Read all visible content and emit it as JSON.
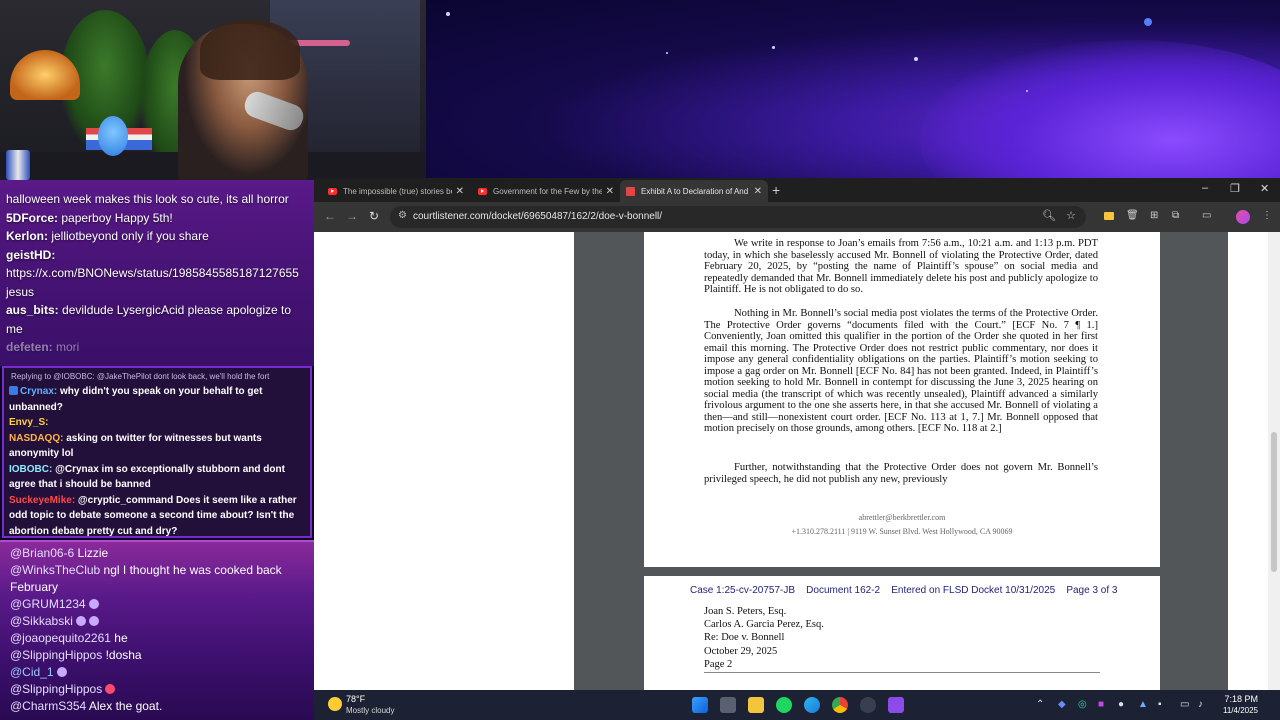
{
  "browser": {
    "tabs": [
      {
        "title": "The impossible (true) stories be",
        "favicon": "youtube-icon",
        "active": false
      },
      {
        "title": "Government for the Few by the",
        "favicon": "youtube-icon",
        "active": false
      },
      {
        "title": "Exhibit A to Declaration of And",
        "favicon": "pdf-icon",
        "active": true
      }
    ],
    "new_tab": "+",
    "minimize": "–",
    "restore": "❐",
    "close": "✕",
    "url": "courtlistener.com/docket/69650487/162/2/doe-v-bonnell/"
  },
  "pdf": {
    "page2": {
      "paragraphs": [
        "We write in response to Joan’s emails from 7:56 a.m., 10:21 a.m. and 1:13 p.m. PDT today, in which she baselessly accused Mr. Bonnell of violating the Protective Order, dated February 20, 2025, by “posting the name of Plaintiff’s spouse” on social media and repeatedly demanded that Mr. Bonnell immediately delete his post and publicly apologize to Plaintiff. He is not obligated to do so.",
        "Nothing in Mr. Bonnell’s social media post violates the terms of the Protective Order. The Protective Order governs “documents filed with the Court.” [ECF No. 7 ¶ 1.] Conveniently, Joan omitted this qualifier in the portion of the Order she quoted in her first email this morning. The Protective Order does not restrict public commentary, nor does it impose any general confidentiality obligations on the parties. Plaintiff’s motion seeking to impose a gag order on Mr. Bonnell [ECF No. 84] has not been granted. Indeed, in Plaintiff’s motion seeking to hold Mr. Bonnell in contempt for discussing the June 3, 2025 hearing on social media (the transcript of which was recently unsealed), Plaintiff advanced a similarly frivolous argument to the one she asserts here, in that she accused Mr. Bonnell of violating a then—and still—nonexistent court order. [ECF No. 113 at 1, 7.] Mr. Bonnell opposed that motion precisely on those grounds, among others. [ECF No. 118 at 2.]",
        "Further, notwithstanding that the Protective Order does not govern Mr. Bonnell’s privileged speech, he did not publish any new, previously"
      ],
      "footer_email": "abrettler@berkbrettler.com",
      "footer_address": "+1.310.278.2111 | 9119 W. Sunset Blvd. West Hollywood, CA 90069"
    },
    "page3": {
      "stamp": "Case 1:25-cv-20757-JB    Document 162-2    Entered on FLSD Docket 10/31/2025    Page 3 of 3",
      "address_lines": [
        "Joan S. Peters, Esq.",
        "Carlos A. Garcia Perez, Esq.",
        "Re: Doe v. Bonnell",
        "October 29, 2025",
        "Page 2"
      ]
    }
  },
  "chat_upper": [
    {
      "user": "",
      "text": "halloween week makes this look so cute, its all horror"
    },
    {
      "user": "5DForce:",
      "text": " paperboy Happy 5th!"
    },
    {
      "user": "Kerlon:",
      "text": " jelliotbeyond only if you share"
    },
    {
      "user": "geistHD:",
      "text": ""
    },
    {
      "user": "",
      "text": "https://x.com/BNONews/status/1985845585187127655"
    },
    {
      "user": "",
      "text": "jesus"
    },
    {
      "user": "aus_bits:",
      "text": " devildude LysergicAcid  please apologize to me"
    },
    {
      "user": "defeten:",
      "text": " mori"
    }
  ],
  "chat_mid": {
    "reply_note": "Replying to @IOBOBC: @JakeThePilot dont look back, we'll hold the fort",
    "messages": [
      {
        "user": "Crynax:",
        "text": " why didn't you speak on your behalf to get unbanned?",
        "color": "#5fb0ff"
      },
      {
        "user": "Envy_S:",
        "text": "",
        "color": "#ffd33a"
      },
      {
        "user": "NASDAQQ:",
        "text": " asking on twitter for witnesses but wants anonymity lol",
        "color": "#ffb347"
      },
      {
        "user": "IOBOBC:",
        "text": " @Crynax im so exceptionally stubborn and dont agree that i should be banned",
        "color": "#8fe8ff"
      },
      {
        "user": "SuckeyeMike:",
        "text": " @cryptic_command Does it seem like a rather odd topic to debate someone a second time about? Isn't the abortion debate pretty cut and dry?",
        "color": "#ff4a4a"
      }
    ]
  },
  "chat_lower": [
    {
      "user": "@Brian06-6",
      "text": " Lizzie"
    },
    {
      "user": "@WinksTheClub",
      "text": " ngl I thought he was cooked back February"
    },
    {
      "user": "@GRUM1234",
      "text": ""
    },
    {
      "user": "@Sikkabski",
      "text": ""
    },
    {
      "user": "@joaopequito2261",
      "text": " he"
    },
    {
      "user": "@SlippingHippos",
      "text": " !dosha"
    },
    {
      "user": "@Cid_1",
      "text": ""
    },
    {
      "user": "@SlippingHippos",
      "text": ""
    },
    {
      "user": "@CharmS354",
      "text": " Alex the goat."
    }
  ],
  "taskbar": {
    "temp": "78°F",
    "weather": "Mostly cloudy",
    "time": "7:18 PM",
    "date": "11/4/2025"
  }
}
